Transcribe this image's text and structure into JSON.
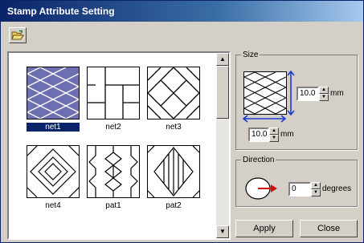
{
  "window": {
    "title": "Stamp Attribute Setting"
  },
  "toolbar": {
    "open_icon": "open-folder-icon"
  },
  "patterns": [
    {
      "label": "net1",
      "selected": true
    },
    {
      "label": "net2",
      "selected": false
    },
    {
      "label": "net3",
      "selected": false
    },
    {
      "label": "net4",
      "selected": false
    },
    {
      "label": "pat1",
      "selected": false
    },
    {
      "label": "pat2",
      "selected": false
    }
  ],
  "size": {
    "legend": "Size",
    "height_value": "10.0",
    "width_value": "10.0",
    "unit": "mm",
    "arrow_color": "#1a3ad6"
  },
  "direction": {
    "legend": "Direction",
    "value": "0",
    "unit": "degrees",
    "arrow_color": "#d01010"
  },
  "buttons": {
    "apply": "Apply",
    "close": "Close"
  }
}
